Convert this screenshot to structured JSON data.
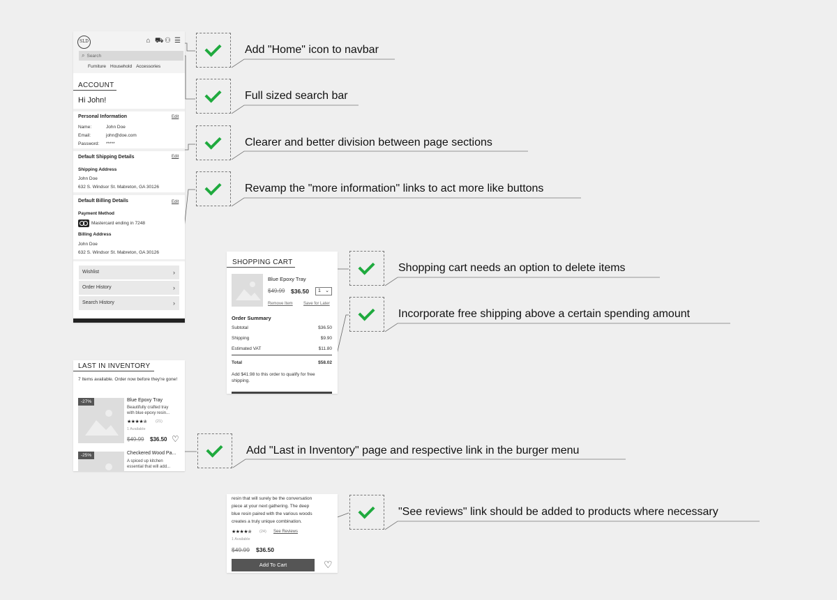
{
  "account_panel": {
    "logo": "SLD",
    "nav_icons": [
      "home-icon",
      "cart-icon",
      "user-icon",
      "menu-icon"
    ],
    "search_placeholder": "Search",
    "categories": [
      "Furniture",
      "Household",
      "Accessories"
    ],
    "title": "ACCOUNT",
    "greeting": "Hi John!",
    "personal": {
      "heading": "Personal Information",
      "edit": "Edit",
      "name_label": "Name:",
      "name_value": "John Doe",
      "email_label": "Email:",
      "email_value": "john@doe.com",
      "password_label": "Password:",
      "password_value": "*****"
    },
    "shipping": {
      "heading": "Default Shipping Details",
      "edit": "Edit",
      "subheading": "Shipping Address",
      "name": "John Doe",
      "address": "632 S. Windsor St. Mabreton, GA 30126"
    },
    "billing": {
      "heading": "Default Billing Details",
      "edit": "Edit",
      "payment_heading": "Payment Method",
      "card_text": "Mastercard ending in 7248",
      "address_heading": "Billing Address",
      "name": "John Doe",
      "address": "632 S. Windsor St. Mabreton, GA 30126"
    },
    "links": [
      "Wishlist",
      "Order History",
      "Search History"
    ]
  },
  "cart_panel": {
    "title": "SHOPPING CART",
    "item_name": "Blue Epoxy Tray",
    "old_price": "$49.99",
    "new_price": "$36.50",
    "qty": "1",
    "remove": "Remove Item",
    "save_later": "Save for Later",
    "summary_heading": "Order Summary",
    "rows": [
      {
        "label": "Subtotal",
        "value": "$36.50"
      },
      {
        "label": "Shipping",
        "value": "$9.90"
      },
      {
        "label": "Estimated VAT",
        "value": "$11.80"
      }
    ],
    "total_label": "Total",
    "total_value": "$58.02",
    "free_shipping_note": "Add $41.98 to this order to qualify for free shipping."
  },
  "inventory_panel": {
    "title": "LAST IN INVENTORY",
    "subtitle": "7 Items available. Order now before they're gone!",
    "items": [
      {
        "discount": "-27%",
        "name": "Blue Epoxy Tray",
        "desc_1": "Beautifully crafted tray",
        "desc_2": "with blue epoxy resin...",
        "stars": "★★★★✯",
        "reviews": "(21)",
        "available": "1 Available",
        "old_price": "$49.99",
        "new_price": "$36.50"
      },
      {
        "discount": "-25%",
        "name": "Checkered Wood Pa...",
        "desc_1": "A spiced up kitchen",
        "desc_2": "essential that will add..."
      }
    ]
  },
  "product_panel": {
    "desc_1": "resin that will surely be the conversation",
    "desc_2": "piece at your next gathering. The deep",
    "desc_3": "blue resin paired with the various woods",
    "desc_4": "creates a truly unique combination.",
    "stars": "★★★★✯",
    "reviews": "(24)",
    "see_reviews": "See Reviews",
    "available": "1 Available",
    "old_price": "$49.99",
    "new_price": "$36.50",
    "add_to_cart": "Add To Cart"
  },
  "notes": [
    "Add \"Home\" icon to navbar",
    "Full sized search bar",
    "Clearer and better division between page sections",
    "Revamp the \"more information\" links to act more like buttons",
    "Shopping cart needs an option to delete items",
    "Incorporate free shipping above a certain spending amount",
    "Add \"Last in Inventory\" page and respective link in the burger menu",
    "\"See reviews\" link should be added to products where necessary"
  ],
  "colors": {
    "check": "#1faa3e",
    "background": "#efefef",
    "dark_button": "#555555"
  }
}
